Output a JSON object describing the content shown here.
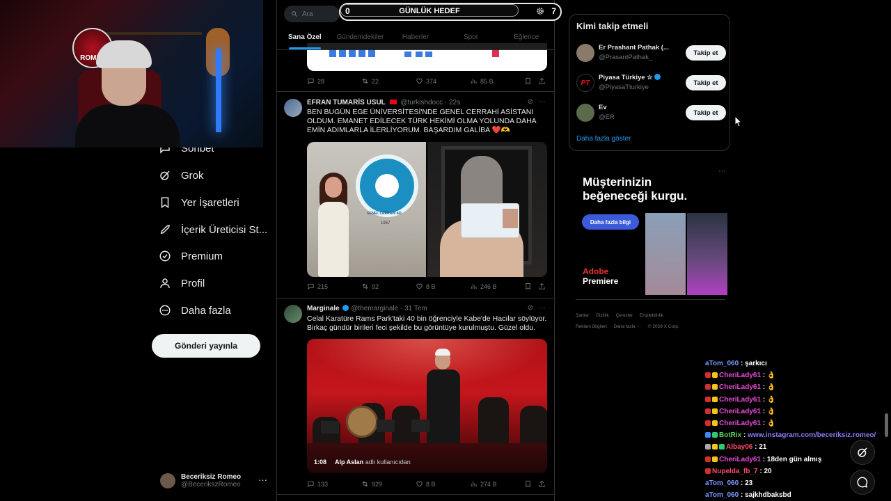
{
  "overlay": {
    "webcam_logo_text": "ROMEO",
    "goal": {
      "title": "GÜNLÜK HEDEF",
      "current": "0",
      "target": "7"
    },
    "chat": [
      {
        "user": "aTom_060",
        "text": "şarkıcı",
        "color": "#7b9bff",
        "badges": []
      },
      {
        "user": "CheriLady61",
        "text": "👌",
        "color": "#e84bd8",
        "badges": [
          "#d32f2f",
          "#f5c518"
        ]
      },
      {
        "user": "CheriLady61",
        "text": "👌",
        "color": "#e84bd8",
        "badges": [
          "#d32f2f",
          "#f5c518"
        ]
      },
      {
        "user": "CheriLady61",
        "text": "👌",
        "color": "#e84bd8",
        "badges": [
          "#d32f2f",
          "#f5c518"
        ]
      },
      {
        "user": "CheriLady61",
        "text": "👌",
        "color": "#e84bd8",
        "badges": [
          "#d32f2f",
          "#f5c518"
        ]
      },
      {
        "user": "CheriLady61",
        "text": "👌",
        "color": "#e84bd8",
        "badges": [
          "#d32f2f",
          "#f5c518"
        ]
      },
      {
        "user": "BotRix",
        "text": "www.instagram.com/beceriksiz.romeo/",
        "color": "#5cd65c",
        "badges": [
          "#3b8bff",
          "#2ecc71"
        ],
        "is_link": true
      },
      {
        "user": "Albay06",
        "text": "21",
        "color": "#ff4d6d",
        "badges": [
          "#aaaaaa",
          "#f5c518",
          "#2ecc71"
        ]
      },
      {
        "user": "CheriLady61",
        "text": "18den gün almış",
        "color": "#e84bd8",
        "badges": [
          "#d32f2f",
          "#f5c518"
        ]
      },
      {
        "user": "Nupelda_fb_7",
        "text": "20",
        "color": "#ff4d6d",
        "badges": [
          "#d32f2f"
        ]
      },
      {
        "user": "aTom_060",
        "text": "23",
        "color": "#7b9bff",
        "badges": []
      },
      {
        "user": "aTom_060",
        "text": "sajkhdbaksbd",
        "color": "#7b9bff",
        "badges": []
      }
    ]
  },
  "nav": {
    "items": [
      {
        "label": "Sohbet",
        "icon": "chat-icon"
      },
      {
        "label": "Grok",
        "icon": "grok-icon"
      },
      {
        "label": "Yer İşaretleri",
        "icon": "bookmark-icon"
      },
      {
        "label": "İçerik Üreticisi St...",
        "icon": "rocket-icon"
      },
      {
        "label": "Premium",
        "icon": "premium-icon"
      },
      {
        "label": "Profil",
        "icon": "person-icon"
      },
      {
        "label": "Daha fazla",
        "icon": "more-circle-icon"
      }
    ],
    "post_button": "Gönderi yayınla",
    "account": {
      "name": "Beceriksiz Romeo",
      "handle": "@BecerikszRomeo"
    }
  },
  "search": {
    "placeholder": "Ara"
  },
  "tabs": [
    {
      "label": "Sana Özel",
      "active": true
    },
    {
      "label": "Gündemdekiler",
      "active": false
    },
    {
      "label": "Haberler",
      "active": false
    },
    {
      "label": "Spor",
      "active": false
    },
    {
      "label": "Eğlence",
      "active": false
    }
  ],
  "timeline": {
    "prev_actions": {
      "replies": "28",
      "reposts": "22",
      "likes": "374",
      "views": "85 B"
    },
    "tweet1": {
      "name": "EFRAN TUMARİS USUL",
      "handle": "@turkishdocc",
      "time": "22s",
      "text": "BEN BUGÜN EGE ÜNİVERSİTESİ'NDE GENEL CERRAHİ ASİSTANI OLDUM. EMANET EDİLECEK TÜRK HEKİMİ OLMA YOLUNDA DAHA EMİN ADIMLARLA İLERLİYORUM. BAŞARDIM GALİBA ❤️🫶",
      "seal_text": "GENEL CERRAHİ AD",
      "seal_year": "1957",
      "actions": {
        "replies": "215",
        "reposts": "92",
        "likes": "8 B",
        "views": "246 B"
      }
    },
    "tweet2": {
      "name": "Marginale",
      "handle": "@themarginale",
      "time": "31 Tem",
      "text": "Celal Karatüre Rams Park'taki 40 bin öğrenciyle Kabe'de Hacılar söylüyor. Birkaç gündür birileri feci şekilde bu görüntüye kurulmuştu. Güzel oldu.",
      "video_time": "1:08",
      "video_credit_name": "Alp Aslan",
      "video_credit_suffix": "adlı kullanıcıdan",
      "actions": {
        "replies": "133",
        "reposts": "929",
        "likes": "8 B",
        "views": "274 B"
      }
    }
  },
  "who_to_follow": {
    "title": "Kimi takip etmeli",
    "users": [
      {
        "name": "Er Prashant Pathak (...",
        "handle": "@PrasantPathak_",
        "button": "Takip et",
        "avatar_color": "#8a7a6a"
      },
      {
        "name": "Piyasa Türkiye ☆",
        "handle": "@PiyasaTturkiye",
        "button": "Takip et",
        "avatar_color": "#000000",
        "verified": true
      },
      {
        "name": "Ev",
        "handle": "@ER",
        "button": "Takip et",
        "avatar_color": "#5a6a4a"
      }
    ],
    "show_more": "Daha fazla göster"
  },
  "ad": {
    "headline_1": "Müşterinizin",
    "headline_2": "beğeneceği kurgu.",
    "cta": "Daha fazla bilgi",
    "brand_1": "Adobe",
    "brand_2": "Premiere"
  },
  "footer": {
    "links": [
      "Şartlar",
      "Gizlilik",
      "Çerezler",
      "Erişilebilirlik",
      "Reklam Bilgileri",
      "Daha fazla ···",
      "© 2026 X Corp."
    ]
  }
}
